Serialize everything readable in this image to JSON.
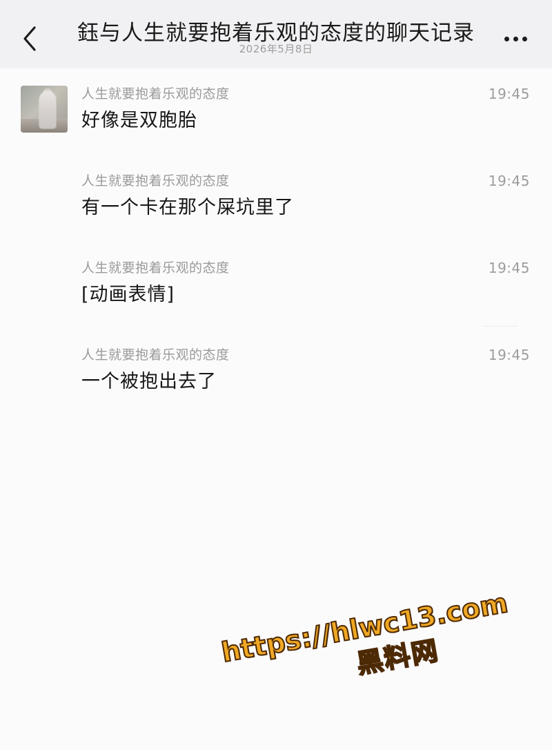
{
  "header": {
    "title": "鈺与人生就要抱着乐观的态度的聊天记录",
    "date": "2026年5月8日"
  },
  "messages": [
    {
      "sender": "人生就要抱着乐观的态度",
      "time": "19:45",
      "content": "好像是双胞胎"
    },
    {
      "sender": "人生就要抱着乐观的态度",
      "time": "19:45",
      "content": "有一个卡在那个屎坑里了"
    },
    {
      "sender": "人生就要抱着乐观的态度",
      "time": "19:45",
      "content": "[动画表情]"
    },
    {
      "sender": "人生就要抱着乐观的态度",
      "time": "19:45",
      "content": "一个被抱出去了"
    }
  ],
  "watermark": {
    "url": "https://hlwc13.com",
    "name": "黑料网"
  },
  "icons": {
    "back": "chevron-left-icon",
    "more": "more-dots-icon",
    "avatar": "avatar-image"
  },
  "colors": {
    "header_bg": "#f1f1f3",
    "page_bg": "#fbfbfc",
    "meta_text": "#9a9a9a",
    "message_text": "#161616",
    "watermark_fill": "#f0a823",
    "watermark_stroke": "#4d2a06"
  }
}
